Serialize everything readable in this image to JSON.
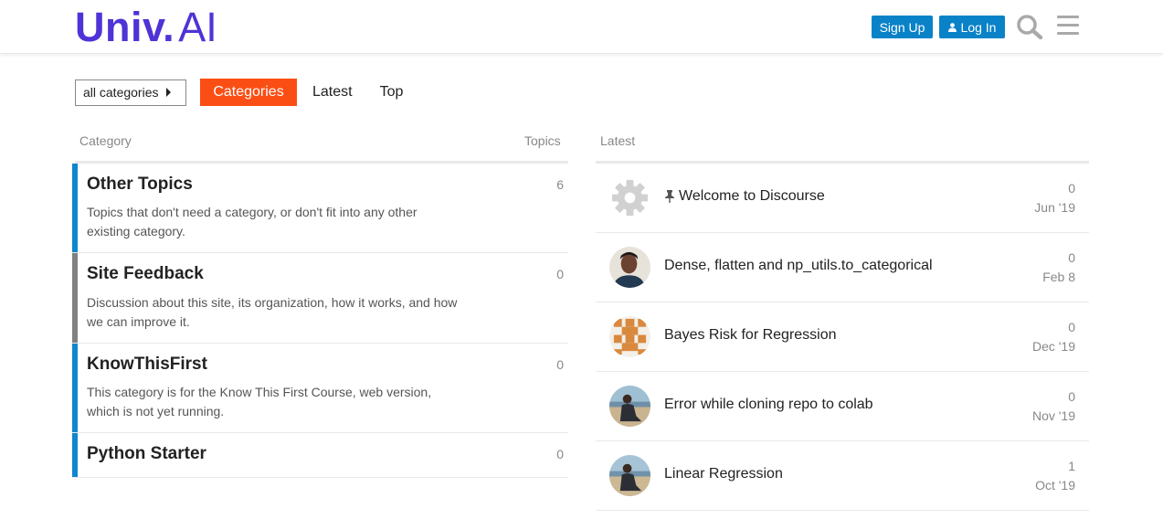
{
  "header": {
    "logo_main": "Univ.",
    "logo_sub": "AI",
    "signup_label": "Sign Up",
    "login_label": "Log In",
    "icons": [
      "search-icon",
      "hamburger-menu-icon",
      "user-icon"
    ],
    "colors": {
      "brand": "#4f33d6",
      "button": "#0a82c8",
      "active_tab": "#fa4e14"
    }
  },
  "nav": {
    "category_dropdown": "all categories",
    "tabs": [
      "Categories",
      "Latest",
      "Top"
    ],
    "active_tab": "Categories"
  },
  "categories": {
    "header_category": "Category",
    "header_topics": "Topics",
    "rows": [
      {
        "name": "Other Topics",
        "description": "Topics that don't need a category, or don't fit into any other existing category.",
        "count": "6",
        "color": "#0e87cd"
      },
      {
        "name": "Site Feedback",
        "description": "Discussion about this site, its organization, how it works, and how we can improve it.",
        "count": "0",
        "color": "#808281"
      },
      {
        "name": "KnowThisFirst",
        "description": "This category is for the Know This First Course, web version, which is not yet running.",
        "count": "0",
        "color": "#0e87cd"
      },
      {
        "name": "Python Starter",
        "description": "",
        "count": "0",
        "color": "#0e87cd"
      }
    ]
  },
  "latest": {
    "header": "Latest",
    "topics": [
      {
        "title": "Welcome to Discourse",
        "replies": "0",
        "date": "Jun '19",
        "pinned": true,
        "avatar": "gear-avatar"
      },
      {
        "title": "Dense, flatten and np_utils.to_categorical",
        "replies": "0",
        "date": "Feb 8",
        "pinned": false,
        "avatar": "user-photo"
      },
      {
        "title": "Bayes Risk for Regression",
        "replies": "0",
        "date": "Dec '19",
        "pinned": false,
        "avatar": "identicon"
      },
      {
        "title": "Error while cloning repo to colab",
        "replies": "0",
        "date": "Nov '19",
        "pinned": false,
        "avatar": "user-photo"
      },
      {
        "title": "Linear Regression",
        "replies": "1",
        "date": "Oct '19",
        "pinned": false,
        "avatar": "user-photo"
      }
    ]
  }
}
